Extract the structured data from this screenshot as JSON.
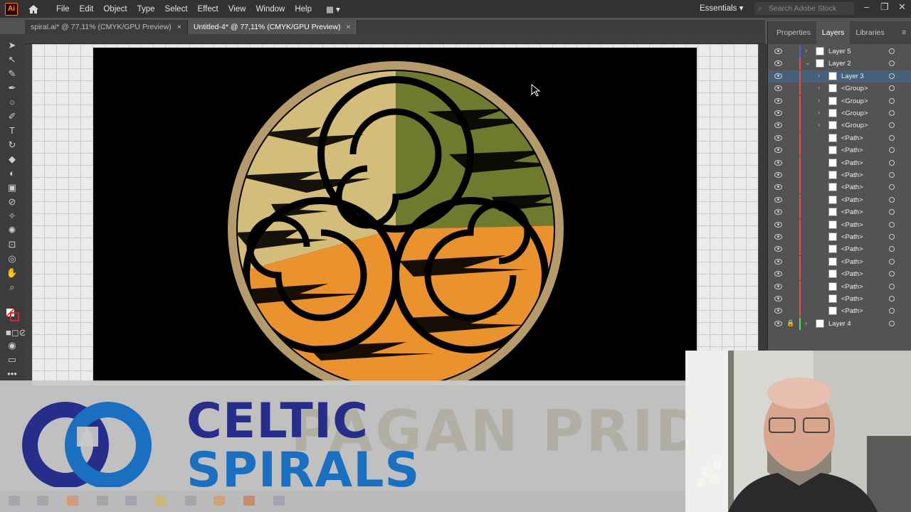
{
  "app": {
    "logo_text": "Ai"
  },
  "menu": [
    "File",
    "Edit",
    "Object",
    "Type",
    "Select",
    "Effect",
    "View",
    "Window",
    "Help"
  ],
  "workspace": {
    "label": "Essentials"
  },
  "search": {
    "placeholder": "Search Adobe Stock"
  },
  "tabs": [
    {
      "label": "spiral.ai* @ 77,11% (CMYK/GPU Preview)",
      "active": false
    },
    {
      "label": "Untitled-4* @ 77,11% (CMYK/GPU Preview)",
      "active": true
    }
  ],
  "panel": {
    "tabs": [
      "Properties",
      "Layers",
      "Libraries"
    ],
    "active_tab": "Layers",
    "layers": [
      {
        "name": "Layer 5",
        "indent": 0,
        "expand": true,
        "color": "#4b5fe8",
        "selected": false
      },
      {
        "name": "Layer 2",
        "indent": 0,
        "expand": true,
        "color": "#e84b4b",
        "selected": false,
        "open": true
      },
      {
        "name": "Layer 3",
        "indent": 1,
        "expand": true,
        "color": "#e84b4b",
        "selected": true
      },
      {
        "name": "<Group>",
        "indent": 1,
        "expand": true,
        "color": "#e84b4b",
        "selected": false
      },
      {
        "name": "<Group>",
        "indent": 1,
        "expand": true,
        "color": "#e84b4b",
        "selected": false
      },
      {
        "name": "<Group>",
        "indent": 1,
        "expand": true,
        "color": "#e84b4b",
        "selected": false
      },
      {
        "name": "<Group>",
        "indent": 1,
        "expand": true,
        "color": "#e84b4b",
        "selected": false
      },
      {
        "name": "<Path>",
        "indent": 1,
        "expand": false,
        "color": "#e84b4b",
        "selected": false
      },
      {
        "name": "<Path>",
        "indent": 1,
        "expand": false,
        "color": "#e84b4b",
        "selected": false
      },
      {
        "name": "<Path>",
        "indent": 1,
        "expand": false,
        "color": "#e84b4b",
        "selected": false
      },
      {
        "name": "<Path>",
        "indent": 1,
        "expand": false,
        "color": "#e84b4b",
        "selected": false
      },
      {
        "name": "<Path>",
        "indent": 1,
        "expand": false,
        "color": "#e84b4b",
        "selected": false
      },
      {
        "name": "<Path>",
        "indent": 1,
        "expand": false,
        "color": "#e84b4b",
        "selected": false
      },
      {
        "name": "<Path>",
        "indent": 1,
        "expand": false,
        "color": "#e84b4b",
        "selected": false
      },
      {
        "name": "<Path>",
        "indent": 1,
        "expand": false,
        "color": "#e84b4b",
        "selected": false
      },
      {
        "name": "<Path>",
        "indent": 1,
        "expand": false,
        "color": "#e84b4b",
        "selected": false
      },
      {
        "name": "<Path>",
        "indent": 1,
        "expand": false,
        "color": "#e84b4b",
        "selected": false
      },
      {
        "name": "<Path>",
        "indent": 1,
        "expand": false,
        "color": "#e84b4b",
        "selected": false
      },
      {
        "name": "<Path>",
        "indent": 1,
        "expand": false,
        "color": "#e84b4b",
        "selected": false
      },
      {
        "name": "<Path>",
        "indent": 1,
        "expand": false,
        "color": "#e84b4b",
        "selected": false
      },
      {
        "name": "<Path>",
        "indent": 1,
        "expand": false,
        "color": "#e84b4b",
        "selected": false
      },
      {
        "name": "<Path>",
        "indent": 1,
        "expand": false,
        "color": "#e84b4b",
        "selected": false
      },
      {
        "name": "Layer 4",
        "indent": 0,
        "expand": true,
        "color": "#4be84b",
        "selected": false,
        "locked": true
      }
    ]
  },
  "artwork": {
    "colors": {
      "olive": "#6f7a2e",
      "tan": "#d4bd7a",
      "orange": "#e9922e",
      "ring": "#b59a6b",
      "bg": "#000000"
    }
  },
  "watermark": {
    "line1": "CELTIC",
    "line2": "SPIRALS",
    "ghost": "PAGAN PRIDE"
  }
}
